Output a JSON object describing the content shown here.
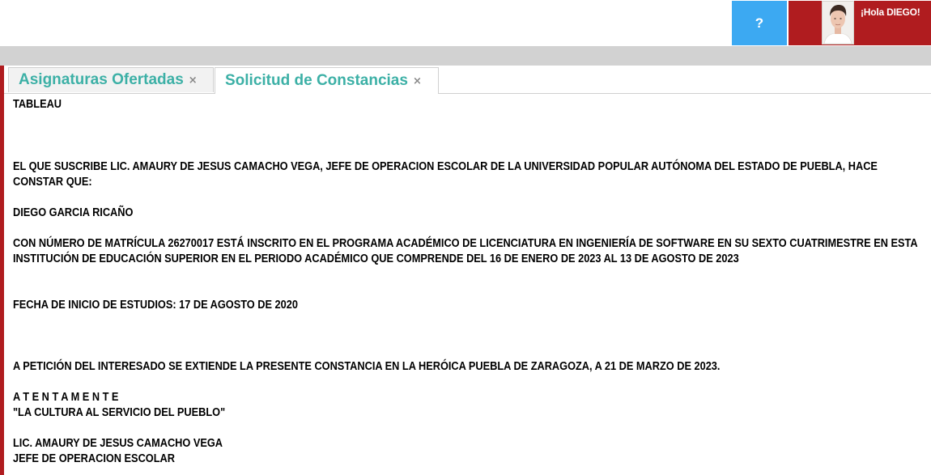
{
  "header": {
    "help_label": "?",
    "greeting": "¡Hola DIEGO!",
    "colors": {
      "help": "#3ca9f2",
      "user": "#b01c1f",
      "tab_text": "#3cb0a6"
    }
  },
  "tabs": [
    {
      "label": "Asignaturas Ofertadas",
      "close": "×"
    },
    {
      "label": "Solicitud de Constancias",
      "close": "×"
    }
  ],
  "document": {
    "title": "TABLEAU",
    "intro": "EL QUE SUSCRIBE LIC. AMAURY DE JESUS CAMACHO VEGA, JEFE DE OPERACION ESCOLAR DE LA UNIVERSIDAD POPULAR AUTÓNOMA DEL ESTADO DE PUEBLA, HACE CONSTAR QUE:",
    "student_name": "DIEGO GARCIA RICAÑO",
    "enrollment": "CON NÚMERO DE MATRÍCULA 26270017 ESTÁ INSCRITO EN EL PROGRAMA ACADÉMICO DE LICENCIATURA EN INGENIERÍA DE SOFTWARE EN SU SEXTO CUATRIMESTRE EN ESTA INSTITUCIÓN DE EDUCACIÓN SUPERIOR EN EL PERIODO ACADÉMICO QUE COMPRENDE DEL 16 DE ENERO DE 2023 AL 13 DE AGOSTO DE 2023",
    "start_date": "FECHA DE INICIO DE ESTUDIOS: 17 DE AGOSTO DE 2020",
    "petition": "A PETICIÓN DEL INTERESADO SE EXTIENDE LA PRESENTE CONSTANCIA EN LA HERÓICA PUEBLA DE ZARAGOZA, A 21 DE MARZO DE 2023.",
    "closing": "A T E N T A M E N T E",
    "motto": "\"LA CULTURA AL SERVICIO DEL PUEBLO\"",
    "signer_name": "LIC. AMAURY DE JESUS CAMACHO VEGA",
    "signer_title": "JEFE DE OPERACION ESCOLAR"
  }
}
